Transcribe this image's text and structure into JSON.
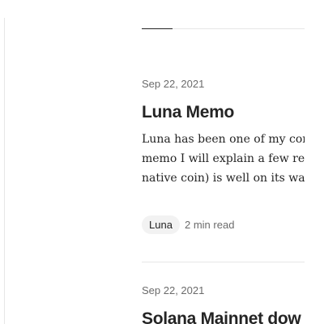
{
  "articles": [
    {
      "date": "Sep 22, 2021",
      "title": "Luna Memo",
      "excerpt": [
        "Luna has been one of my core",
        "memo I will explain a few rea",
        "native coin) is well on its way"
      ],
      "tag": "Luna",
      "read_time": "2 min read"
    },
    {
      "date": "Sep 22, 2021",
      "title": "Solana Mainnet dow"
    }
  ]
}
